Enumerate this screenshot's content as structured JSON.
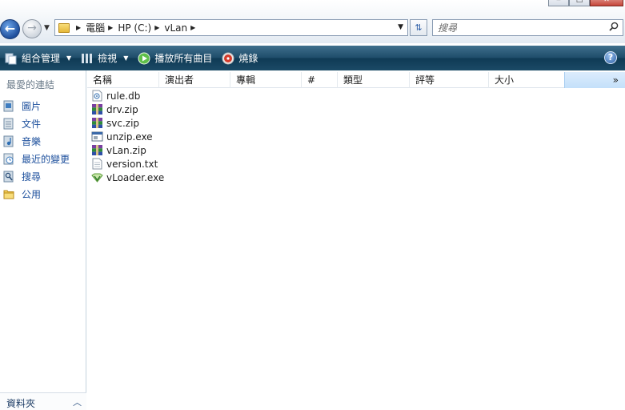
{
  "window": {
    "min_glyph": "‒",
    "max_glyph": "□",
    "close_glyph": "✕"
  },
  "address": {
    "crumbs": [
      "電腦",
      "HP (C:)",
      "vLan"
    ]
  },
  "search": {
    "placeholder": "搜尋"
  },
  "toolbar": {
    "organize_label": "組合管理",
    "views_label": "檢視",
    "play_all_label": "播放所有曲目",
    "burn_label": "燒錄",
    "help_glyph": "?"
  },
  "nav_pane": {
    "favorites_header": "最愛的連結",
    "items": [
      {
        "label": "圖片",
        "icon": "pictures-icon"
      },
      {
        "label": "文件",
        "icon": "documents-icon"
      },
      {
        "label": "音樂",
        "icon": "music-icon"
      },
      {
        "label": "最近的變更",
        "icon": "recent-changes-icon"
      },
      {
        "label": "搜尋",
        "icon": "searches-icon"
      },
      {
        "label": "公用",
        "icon": "public-folder-icon"
      }
    ],
    "folders_label": "資料夾",
    "folders_arrow": "︿"
  },
  "columns": {
    "name": "名稱",
    "artist": "演出者",
    "album": "專輯",
    "track": "#",
    "genre": "類型",
    "rating": "評等",
    "size": "大小",
    "more": "»"
  },
  "files": [
    {
      "name": "rule.db",
      "icon": "db-file-icon"
    },
    {
      "name": "drv.zip",
      "icon": "winrar-archive-icon"
    },
    {
      "name": "svc.zip",
      "icon": "winrar-archive-icon"
    },
    {
      "name": "unzip.exe",
      "icon": "exe-window-icon"
    },
    {
      "name": "vLan.zip",
      "icon": "winrar-archive-icon"
    },
    {
      "name": "version.txt",
      "icon": "text-file-icon"
    },
    {
      "name": "vLoader.exe",
      "icon": "vloader-app-icon"
    }
  ]
}
